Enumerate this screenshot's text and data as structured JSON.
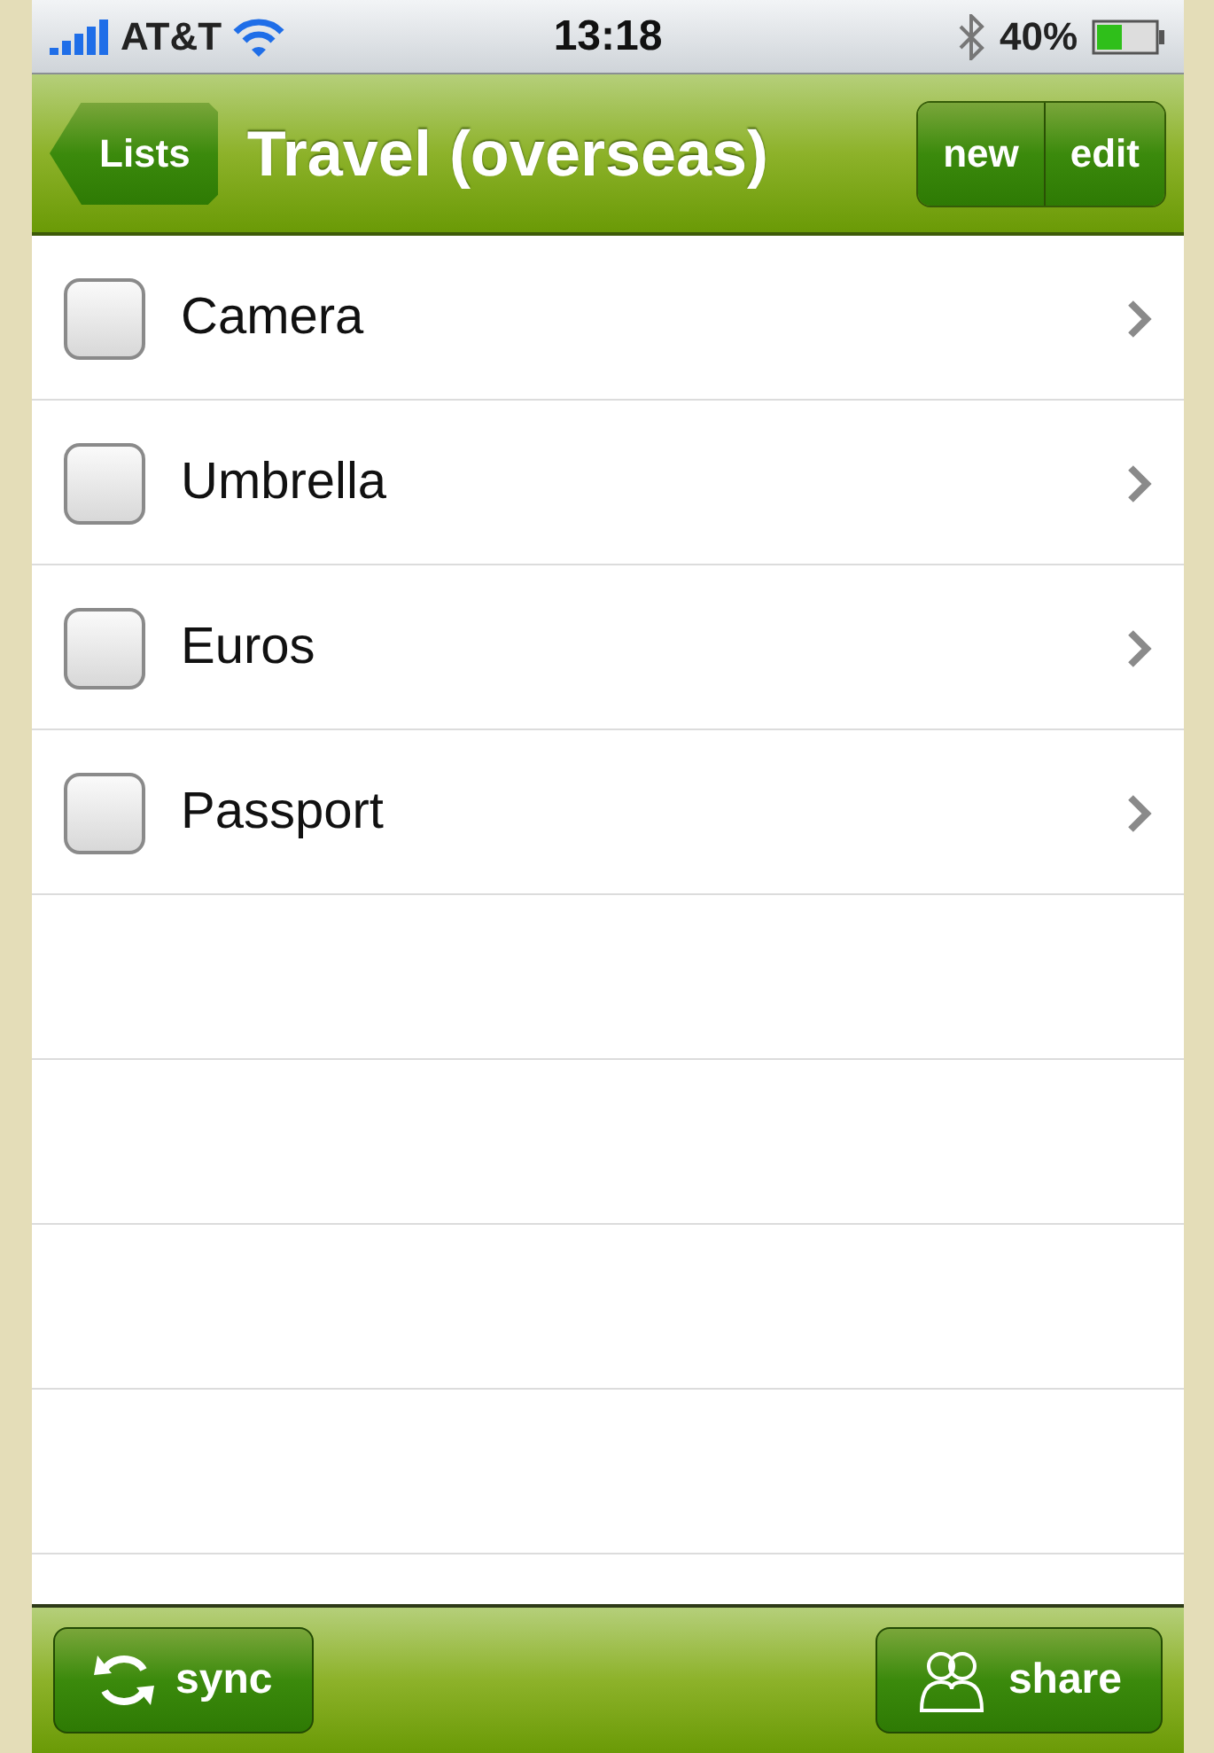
{
  "status_bar": {
    "carrier": "AT&T",
    "time": "13:18",
    "battery": "40%"
  },
  "nav_bar": {
    "back": "Lists",
    "title": "Travel (overseas)",
    "buttons": [
      "new",
      "edit"
    ]
  },
  "items": [
    {
      "label": "Camera",
      "checked": false
    },
    {
      "label": "Umbrella",
      "checked": false
    },
    {
      "label": "Euros",
      "checked": false
    },
    {
      "label": "Passport",
      "checked": false
    }
  ],
  "toolbar": {
    "sync": "sync",
    "share": "share"
  }
}
